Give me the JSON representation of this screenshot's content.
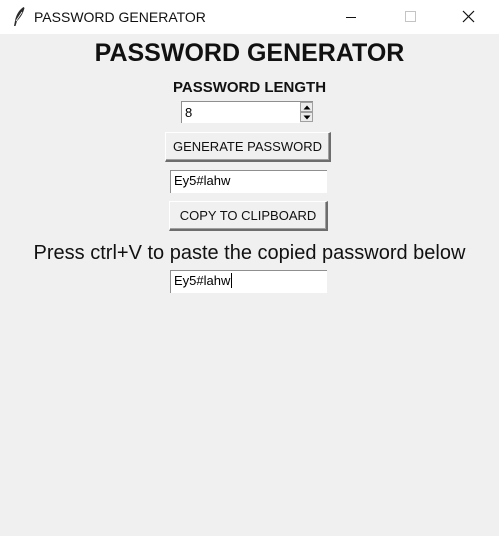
{
  "window": {
    "title": "PASSWORD GENERATOR",
    "icon": "feather-icon",
    "controls": [
      "minimize-icon",
      "maximize-icon",
      "close-icon"
    ]
  },
  "main": {
    "heading": "PASSWORD GENERATOR",
    "length_label": "PASSWORD LENGTH",
    "length_value": "8",
    "generate_button": "GENERATE PASSWORD",
    "generated_password": "Ey5#lahw",
    "copy_button": "COPY TO CLIPBOARD",
    "instruction": "Press ctrl+V to paste the copied password below",
    "pasted_password": "Ey5#lahw"
  }
}
